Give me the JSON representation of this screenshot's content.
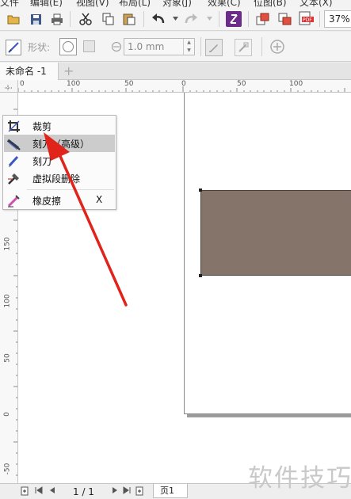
{
  "menubar": {
    "items": [
      "文件",
      "编辑(E)",
      "视图(V)",
      "布局(L)",
      "对象(J)",
      "效果(C)",
      "位图(B)",
      "文本(X)"
    ]
  },
  "toolbar": {
    "zoom": "37%"
  },
  "property_bar": {
    "shape_label": "形状:",
    "outline_width": "1.0 mm"
  },
  "document_tab": {
    "title": "未命名 -1"
  },
  "rulers": {
    "horizontal_labels": [
      "0",
      "100",
      "50",
      "0",
      "50",
      "100"
    ],
    "vertical_labels": [
      "150",
      "100",
      "50",
      "0",
      "-50"
    ]
  },
  "flyout_menu": {
    "items": [
      {
        "label": "裁剪",
        "shortcut": "",
        "icon": "crop-icon",
        "highlighted": false
      },
      {
        "label": "刻刀（高级）",
        "shortcut": "",
        "icon": "knife-advanced-icon",
        "highlighted": true
      },
      {
        "label": "刻刀",
        "shortcut": "",
        "icon": "knife-icon",
        "highlighted": false
      },
      {
        "label": "虚拟段删除",
        "shortcut": "",
        "icon": "virtual-segment-delete-icon",
        "highlighted": false
      },
      {
        "label": "橡皮擦",
        "shortcut": "X",
        "icon": "eraser-icon",
        "highlighted": false
      }
    ]
  },
  "page_nav": {
    "page_count": "1 / 1",
    "page_tab": "页1"
  },
  "watermark": {
    "text": "软件技巧"
  },
  "colors": {
    "rectangle_fill": "#857469",
    "arrow": "#e0241c",
    "menu_highlight": "#cccccc"
  }
}
